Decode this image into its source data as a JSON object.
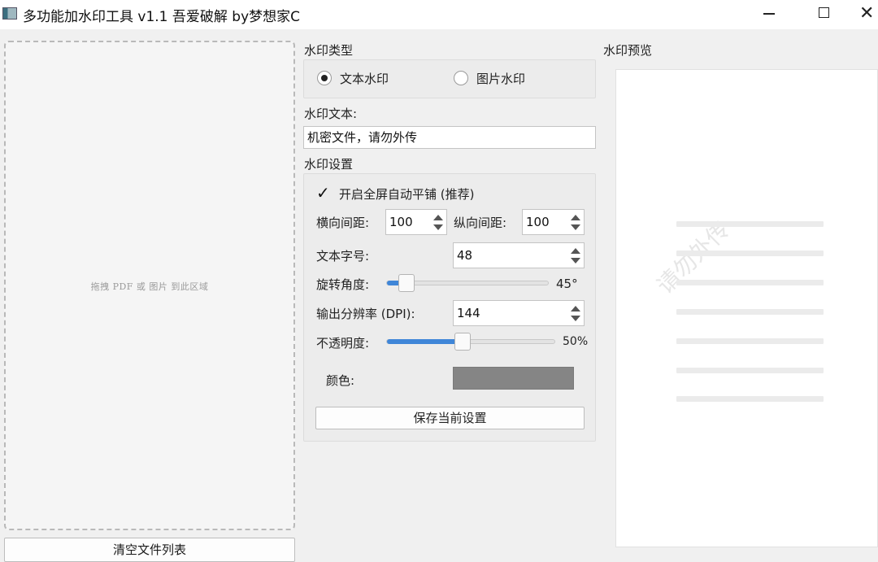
{
  "window": {
    "title": "多功能加水印工具 v1.1 吾爱破解 by梦想家C",
    "icon": "app-icon",
    "min_icon": "minimize-icon",
    "max_icon": "maximize-icon",
    "close_icon": "close-icon",
    "close_glyph": "✕"
  },
  "file_panel": {
    "drop_hint": "拖拽 PDF 或 图片 到此区域",
    "clear_button": "清空文件列表"
  },
  "type_section": {
    "label": "水印类型",
    "options": [
      {
        "label": "文本水印",
        "checked": true
      },
      {
        "label": "图片水印",
        "checked": false
      }
    ]
  },
  "text_section": {
    "label": "水印文本:",
    "value": "机密文件，请勿外传"
  },
  "settings": {
    "label": "水印设置",
    "tile_checkbox": {
      "label": "开启全屏自动平铺 (推荐)",
      "checked": true,
      "mark": "✓"
    },
    "h_spacing": {
      "label": "横向间距:",
      "value": "100"
    },
    "v_spacing": {
      "label": "纵向间距:",
      "value": "100"
    },
    "font_size": {
      "label": "文本字号:",
      "value": "48"
    },
    "rotation": {
      "label": "旋转角度:",
      "value": "45°",
      "fraction": 0.12
    },
    "dpi": {
      "label": "输出分辨率 (DPI):",
      "value": "144"
    },
    "opacity": {
      "label": "不透明度:",
      "value": "50%",
      "fraction": 0.45
    },
    "color": {
      "label": "颜色:",
      "hex": "#858585"
    },
    "save_button": "保存当前设置"
  },
  "preview": {
    "label": "水印预览",
    "watermark_text": "请勿外传"
  },
  "colors": {
    "accent": "#3f86d8",
    "background": "#f0f0f0"
  }
}
